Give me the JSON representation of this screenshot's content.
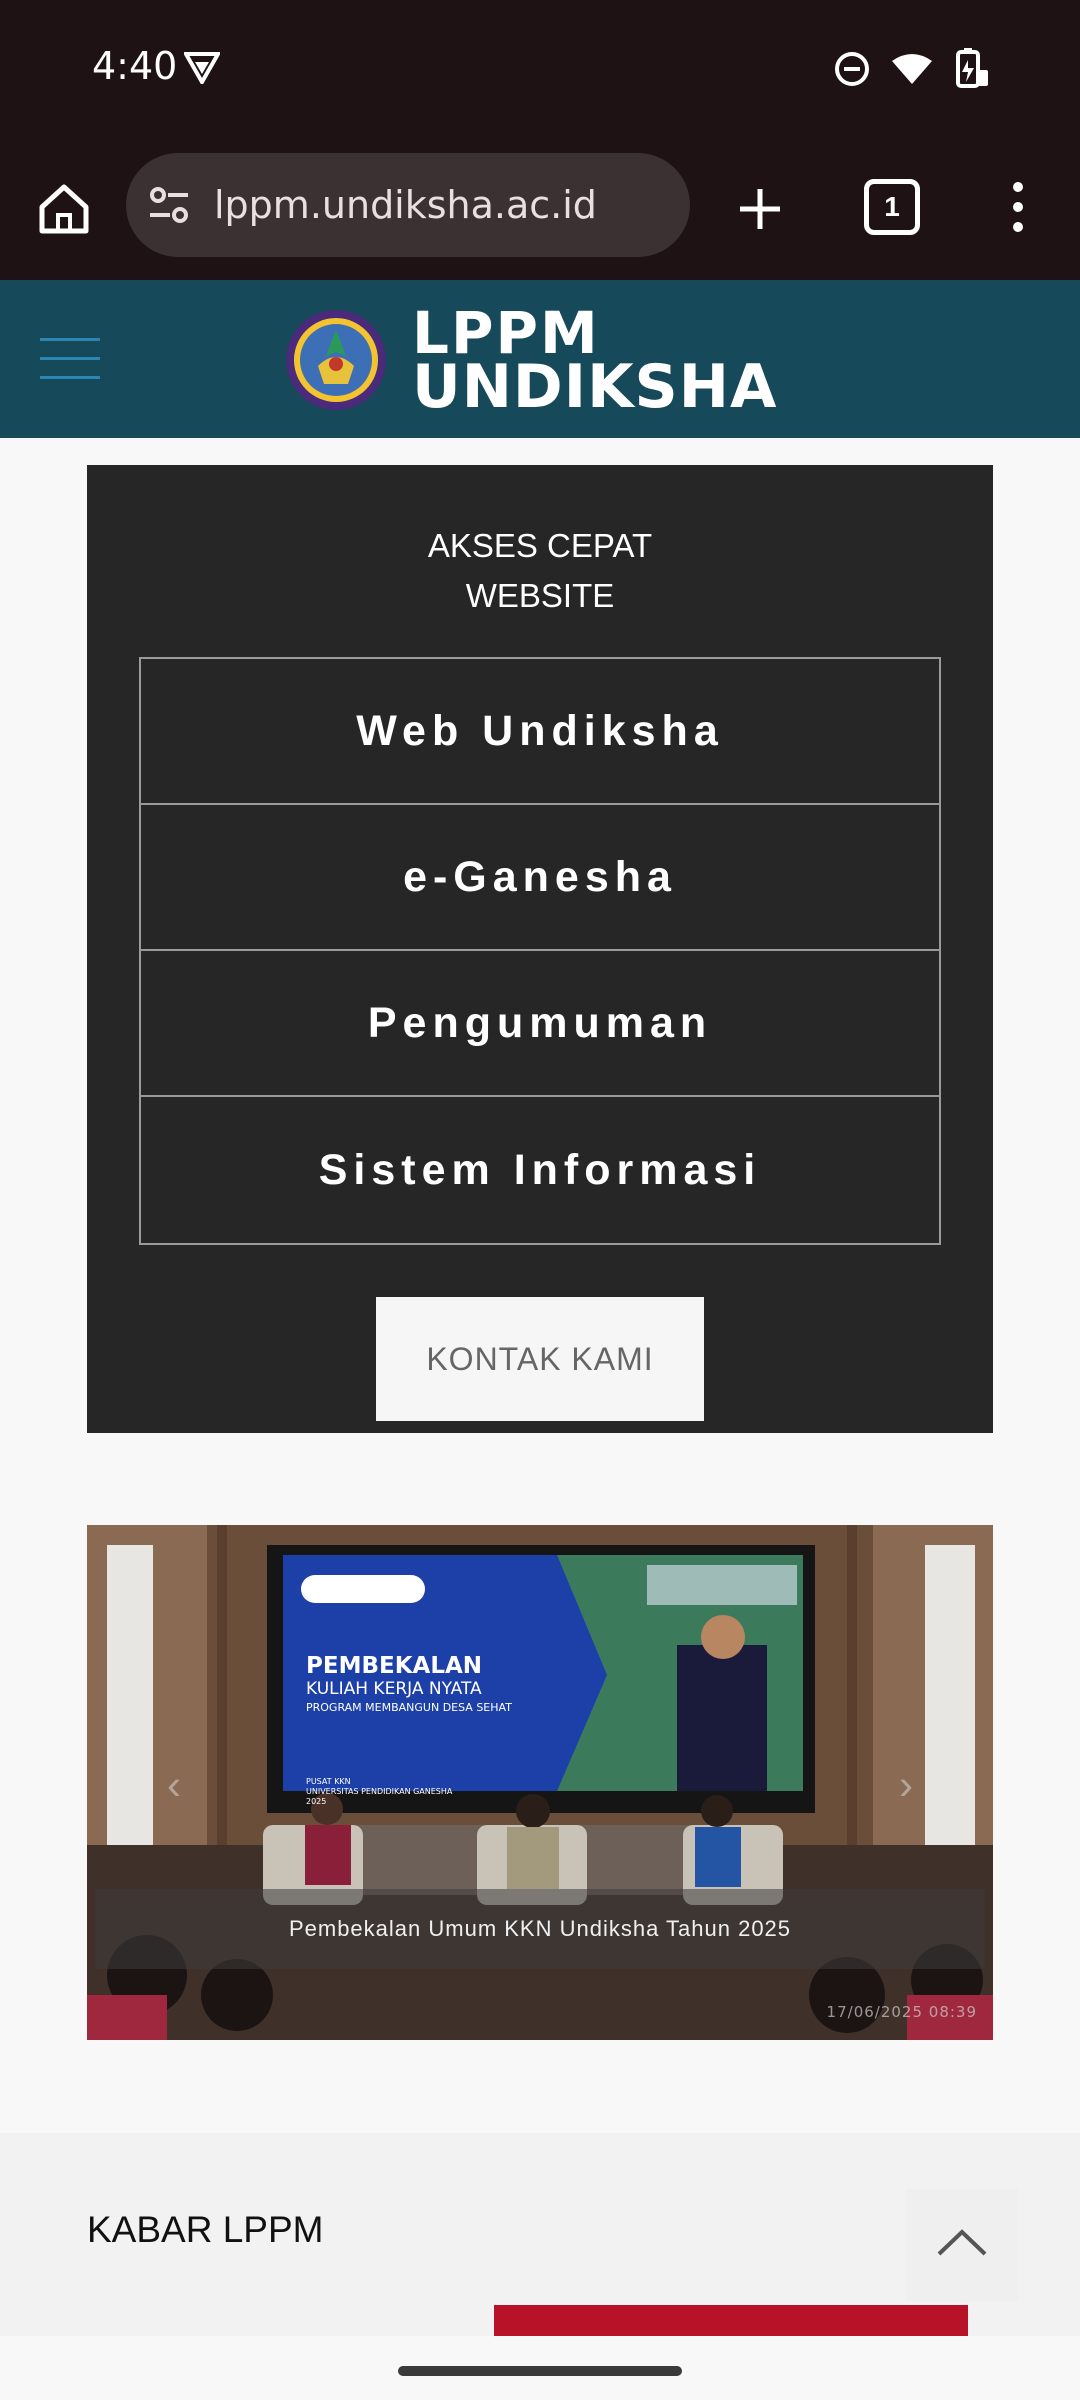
{
  "status_bar": {
    "time": "4:40"
  },
  "browser": {
    "url": "lppm.undiksha.ac.id",
    "tab_count": "1"
  },
  "site": {
    "logo_line1": "LPPM",
    "logo_line2": "UNDIKSHA"
  },
  "quick_access": {
    "title_line1": "AKSES CEPAT",
    "title_line2": "WEBSITE",
    "items": [
      {
        "label": "Web Undiksha"
      },
      {
        "label": "e-Ganesha"
      },
      {
        "label": "Pengumuman"
      },
      {
        "label": "Sistem Informasi"
      }
    ],
    "contact_label": "KONTAK KAMI"
  },
  "carousel": {
    "screen_heading": "PEMBEKALAN",
    "screen_sub1": "KULIAH KERJA NYATA",
    "screen_sub2": "PROGRAM MEMBANGUN DESA SEHAT",
    "screen_org1": "PUSAT KKN",
    "screen_org2": "UNIVERSITAS PENDIDIKAN GANESHA",
    "screen_year": "2025",
    "caption": "Pembekalan Umum KKN Undiksha Tahun 2025",
    "date": "17/06/2025  08:39"
  },
  "kabar": {
    "title": "KABAR LPPM"
  },
  "colors": {
    "status_bg": "#1e1215",
    "header_bg": "#16495a",
    "panel_bg": "#262626",
    "accent_red": "#b71228"
  }
}
